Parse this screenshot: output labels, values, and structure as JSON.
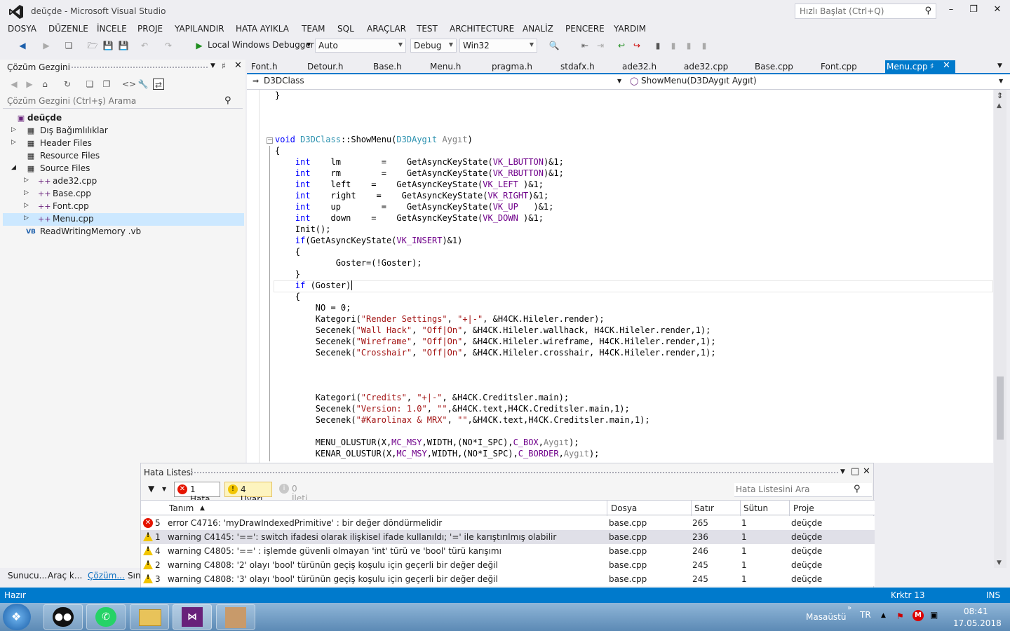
{
  "window": {
    "title": "deüçde - Microsoft Visual Studio",
    "quick_launch_placeholder": "Hızlı Başlat (Ctrl+Q)"
  },
  "menu": [
    "DOSYA",
    "DÜZENLE",
    "İNCELE",
    "PROJE",
    "YAPILANDIR",
    "HATA AYIKLA",
    "TEAM",
    "SQL",
    "ARAÇLAR",
    "TEST",
    "ARCHITECTURE",
    "ANALİZ",
    "PENCERE",
    "YARDIM"
  ],
  "toolbar": {
    "debugger": "Local Windows Debugger",
    "solution_config": "Auto",
    "config": "Debug",
    "platform": "Win32"
  },
  "solution_explorer": {
    "title": "Çözüm Gezgini",
    "search_placeholder": "Çözüm Gezgini (Ctrl+ş) Arama",
    "items": [
      {
        "label": "deüçde",
        "bold": true
      },
      {
        "label": "Dış Bağımlılıklar"
      },
      {
        "label": "Header Files"
      },
      {
        "label": "Resource Files"
      },
      {
        "label": "Source Files"
      },
      {
        "label": "ade32.cpp"
      },
      {
        "label": "Base.cpp"
      },
      {
        "label": "Font.cpp"
      },
      {
        "label": "Menu.cpp"
      },
      {
        "label": "ReadWritingMemory .vb"
      }
    ],
    "bottom_tabs": [
      "Sunucu...",
      "Araç k...",
      "Çözüm...",
      "Sını"
    ]
  },
  "doc_tabs": [
    "Font.h",
    "Detour.h",
    "Base.h",
    "Menu.h",
    "pragma.h",
    "stdafx.h",
    "ade32.h",
    "ade32.cpp",
    "Base.cpp",
    "Font.cpp"
  ],
  "active_tab": "Menu.cpp",
  "navbar": {
    "class": "D3DClass",
    "member": "ShowMenu(D3DAygıt Aygıt)"
  },
  "code": {
    "l01": "}",
    "fn_void": "void",
    "fn_class": "D3DClass",
    "fn_name": "::ShowMenu(",
    "fn_ptype": "D3DAygıt",
    "fn_pname": "Aygıt",
    "fn_close": ")",
    "l03": "{",
    "int": "int",
    "v_lm": "lm        =    GetAsyncKeyState(",
    "m_lm": "VK_LBUTTON",
    "e_lm": ")&1;",
    "v_rm": "rm        =    GetAsyncKeyState(",
    "m_rm": "VK_RBUTTON",
    "e_rm": ")&1;",
    "v_left": "left    =    GetAsyncKeyState(",
    "m_left": "VK_LEFT",
    "e_left": " )&1;",
    "v_right": "right    =    GetAsyncKeyState(",
    "m_right": "VK_RIGHT",
    "e_right": ")&1;",
    "v_up": "up        =    GetAsyncKeyState(",
    "m_up": "VK_UP",
    "e_up": "   )&1;",
    "v_down": "down    =    GetAsyncKeyState(",
    "m_down": "VK_DOWN",
    "e_down": " )&1;",
    "init": "Init();",
    "if1a": "if",
    "if1b": "(GetAsyncKeyState(",
    "if1m": "VK_INSERT",
    "if1c": ")&1)",
    "ob": "{",
    "cb": "}",
    "goster": "Goster=(!Goster);",
    "if2a": "if",
    "if2b": " (Goster)",
    "no": "NO = 0;",
    "k1a": "Kategori(",
    "k1s1": "\"Render Settings\"",
    "k1c": ", ",
    "k1s2": "\"+|-\"",
    "k1d": ", &H4CK.Hileler.render);",
    "s1a": "Secenek(",
    "s1s1": "\"Wall Hack\"",
    "s1c": ", ",
    "s1s2": "\"Off|On\"",
    "s1d": ", &H4CK.Hileler.wallhack, H4CK.Hileler.render,1);",
    "s2a": "Secenek(",
    "s2s1": "\"Wireframe\"",
    "s2c": ", ",
    "s2s2": "\"Off|On\"",
    "s2d": ", &H4CK.Hileler.wireframe, H4CK.Hileler.render,1);",
    "s3a": "Secenek(",
    "s3s1": "\"Crosshair\"",
    "s3c": ", ",
    "s3s2": "\"Off|On\"",
    "s3d": ", &H4CK.Hileler.crosshair, H4CK.Hileler.render,1);",
    "k2a": "Kategori(",
    "k2s1": "\"Credits\"",
    "k2c": ", ",
    "k2s2": "\"+|-\"",
    "k2d": ", &H4CK.Creditsler.main);",
    "s4a": "Secenek(",
    "s4s1": "\"Version: 1.0\"",
    "s4c": ", ",
    "s4s2": "\"\"",
    "s4d": ",&H4CK.text,H4CK.Creditsler.main,1);",
    "s5a": "Secenek(",
    "s5s1": "\"#Karolinax & MRX\"",
    "s5c": ", ",
    "s5s2": "\"\"",
    "s5d": ",&H4CK.text,H4CK.Creditsler.main,1);",
    "mo_a": "MENU_OLUSTUR(X,",
    "mo_m1": "MC_MSY",
    "mo_b": ",WIDTH,(NO*I_SPC),",
    "mo_m2": "C_BOX",
    "mo_c": ",",
    "mo_p": "Aygıt",
    "mo_d": ");",
    "ko_a": "KENAR_OLUSTUR(X,",
    "ko_m1": "MC_MSY",
    "ko_b": ",WIDTH,(NO*I_SPC),",
    "ko_m2": "C_BORDER",
    "ko_c": ",",
    "ko_p": "Aygıt",
    "ko_d": ");"
  },
  "error_list": {
    "title": "Hata Listesi",
    "errors_btn": "1 Hata",
    "warnings_btn": "4 Uyarı",
    "messages_btn": "0 İleti",
    "search_placeholder": "Hata Listesini Ara",
    "columns": {
      "desc": "Tanım",
      "file": "Dosya",
      "line": "Satır",
      "col": "Sütun",
      "project": "Proje"
    },
    "rows": [
      {
        "type": "error",
        "num": "5",
        "desc": "error C4716: 'myDrawIndexedPrimitive' : bir değer döndürmelidir",
        "file": "base.cpp",
        "line": "265",
        "col": "1",
        "project": "deüçde"
      },
      {
        "type": "warning",
        "num": "1",
        "desc": "warning C4145: '==': switch ifadesi olarak ilişkisel ifade kullanıldı; '=' ile karıştırılmış olabilir",
        "file": "base.cpp",
        "line": "236",
        "col": "1",
        "project": "deüçde"
      },
      {
        "type": "warning",
        "num": "4",
        "desc": "warning C4805: '==' : işlemde güvenli olmayan 'int' türü ve 'bool' türü karışımı",
        "file": "base.cpp",
        "line": "246",
        "col": "1",
        "project": "deüçde"
      },
      {
        "type": "warning",
        "num": "2",
        "desc": "warning C4808: '2' olayı 'bool' türünün geçiş koşulu için geçerli bir değer değil",
        "file": "base.cpp",
        "line": "245",
        "col": "1",
        "project": "deüçde"
      },
      {
        "type": "warning",
        "num": "3",
        "desc": "warning C4808: '3' olayı 'bool' türünün geçiş koşulu için geçerli bir değer değil",
        "file": "base.cpp",
        "line": "245",
        "col": "1",
        "project": "deüçde"
      }
    ]
  },
  "statusbar": {
    "left": "Hazır",
    "position": "Krktr 13",
    "mode": "INS"
  },
  "taskbar": {
    "desktop": "Masaüstü",
    "lang": "TR",
    "time": "08:41",
    "date": "17.05.2018"
  },
  "colors": {
    "accent": "#007acc",
    "error": "#e51400",
    "warning": "#f2c500"
  }
}
